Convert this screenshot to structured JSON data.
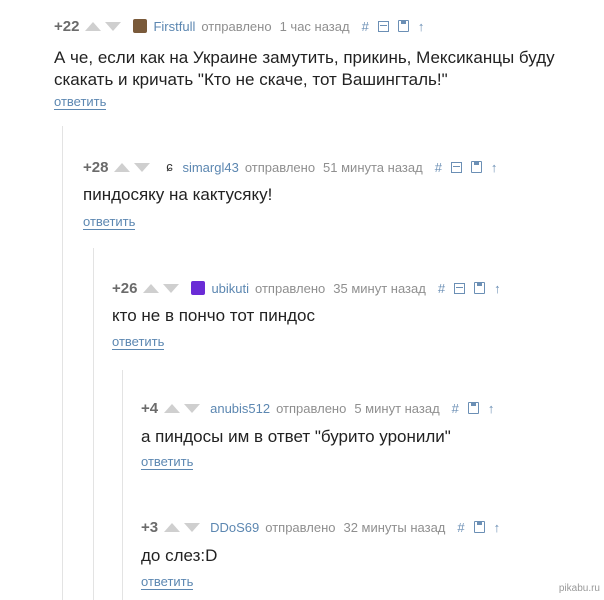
{
  "colors": {
    "link": "#5c87b1",
    "meta": "#8f8f8f",
    "text": "#222222",
    "arrow": "#cfcfcf"
  },
  "comments": [
    {
      "rating": "+22",
      "user": "Firstfull",
      "sent": "отправлено",
      "time": "1 час назад",
      "avatar_color": "#7a5a3a",
      "text": "А че, если как на Украине замутить, прикинь, Мексиканцы буду скакать и кричать \"Кто не скаче, тот Вашингталь!\"",
      "reply": "ответить"
    },
    {
      "rating": "+28",
      "user": "simargl43",
      "sent": "отправлено",
      "time": "51 минута назад",
      "avatar_color": "#333333",
      "text": "пиндосяку на кактусяку!",
      "reply": "ответить"
    },
    {
      "rating": "+26",
      "user": "ubikuti",
      "sent": "отправлено",
      "time": "35 минут назад",
      "avatar_color": "#6a2bd6",
      "text": "кто не в пончо тот пиндос",
      "reply": "ответить"
    },
    {
      "rating": "+4",
      "user": "anubis512",
      "sent": "отправлено",
      "time": "5 минут назад",
      "avatar_color": "",
      "text": "а пиндосы им в ответ \"бурито уронили\"",
      "reply": "ответить"
    },
    {
      "rating": "+3",
      "user": "DDoS69",
      "sent": "отправлено",
      "time": "32 минуты назад",
      "avatar_color": "",
      "text": "до слез:D",
      "reply": "ответить"
    }
  ],
  "tools": {
    "hash": "#",
    "up": "↑"
  },
  "watermark": "pikabu.ru"
}
